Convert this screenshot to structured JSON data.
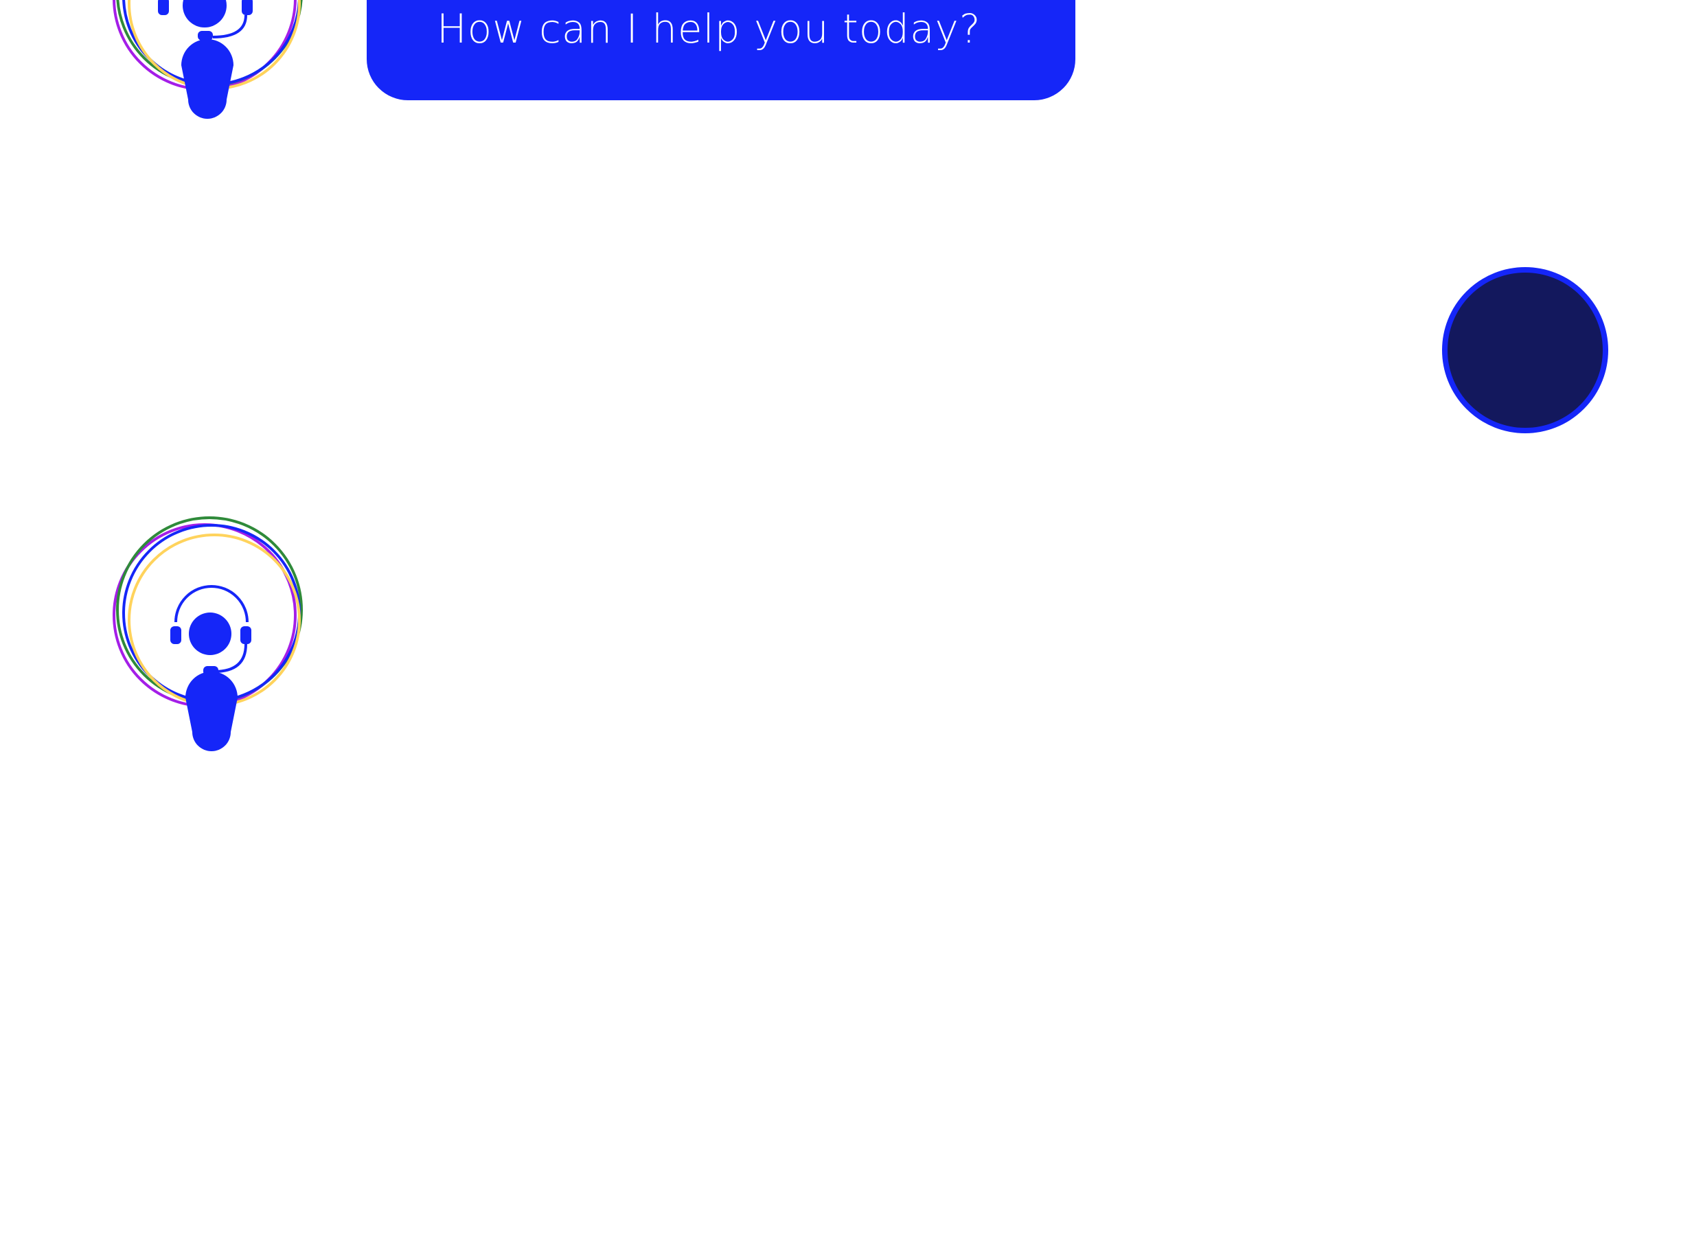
{
  "colors": {
    "accent": "#1526f8",
    "button_fill": "#13185d",
    "ring_purple": "#a41ee8",
    "ring_green": "#2f8a3a",
    "ring_blue": "#1526f8",
    "ring_yellow": "#ffd35c"
  },
  "assistant": {
    "greeting": "How can I help you today?"
  },
  "icons": {
    "assistant_avatar": "support-agent-headset-icon",
    "action_button": "record-circle-icon"
  }
}
